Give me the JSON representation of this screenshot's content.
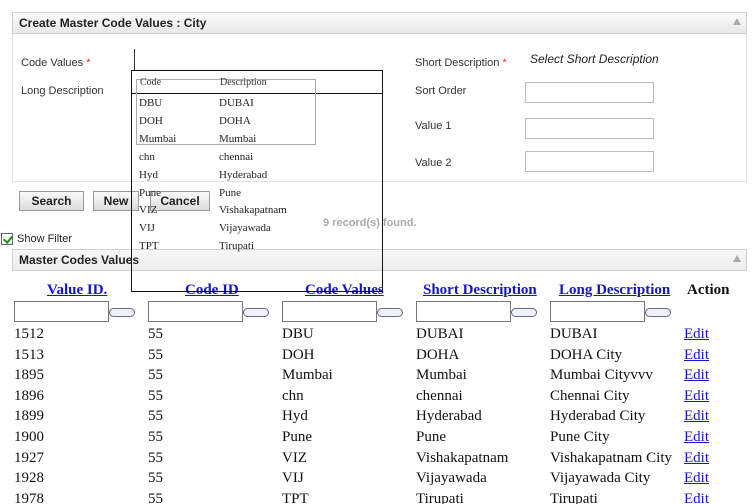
{
  "create_panel": {
    "title": "Create Master Code Values : City",
    "code_values_label": "Code Values",
    "long_description_label": "Long Description",
    "short_description_label": "Short Description",
    "short_description_value": "Select Short Description",
    "sort_order_label": "Sort Order",
    "value1_label": "Value 1",
    "value2_label": "Value 2",
    "required_mark": "*"
  },
  "buttons": {
    "search": "Search",
    "new": "New",
    "cancel": "Cancel"
  },
  "records_found": "9 record(s) found.",
  "show_filter": "Show Filter",
  "list_panel": {
    "title": "Master Codes Values"
  },
  "lookup": {
    "headers": {
      "code": "Code",
      "description": "Description"
    },
    "rows": [
      {
        "code": "DBU",
        "description": "DUBAI"
      },
      {
        "code": "DOH",
        "description": "DOHA"
      },
      {
        "code": "Mumbai",
        "description": "Mumbai"
      },
      {
        "code": "chn",
        "description": "chennai"
      },
      {
        "code": "Hyd",
        "description": "Hyderabad"
      },
      {
        "code": "Pune",
        "description": "Pune"
      },
      {
        "code": "VIZ",
        "description": "Vishakapatnam"
      },
      {
        "code": "VIJ",
        "description": "Vijayawada"
      },
      {
        "code": "TPT",
        "description": "Tirupati"
      }
    ]
  },
  "table": {
    "columns": [
      "Value ID.",
      "Code ID",
      "Code Values",
      "Short Description",
      "Long Description",
      "Action"
    ],
    "rows": [
      {
        "value_id": "1512",
        "code_id": "55",
        "code_value": "DBU",
        "short": "DUBAI",
        "long": "DUBAI",
        "action": "Edit"
      },
      {
        "value_id": "1513",
        "code_id": "55",
        "code_value": "DOH",
        "short": "DOHA",
        "long": "DOHA City",
        "action": "Edit"
      },
      {
        "value_id": "1895",
        "code_id": "55",
        "code_value": "Mumbai",
        "short": "Mumbai",
        "long": "Mumbai Cityvvv",
        "action": "Edit"
      },
      {
        "value_id": "1896",
        "code_id": "55",
        "code_value": "chn",
        "short": "chennai",
        "long": "Chennai City",
        "action": "Edit"
      },
      {
        "value_id": "1899",
        "code_id": "55",
        "code_value": "Hyd",
        "short": "Hyderabad",
        "long": "Hyderabad City",
        "action": "Edit"
      },
      {
        "value_id": "1900",
        "code_id": "55",
        "code_value": "Pune",
        "short": "Pune",
        "long": "Pune City",
        "action": "Edit"
      },
      {
        "value_id": "1927",
        "code_id": "55",
        "code_value": "VIZ",
        "short": "Vishakapatnam",
        "long": "Vishakapatnam City",
        "action": "Edit"
      },
      {
        "value_id": "1928",
        "code_id": "55",
        "code_value": "VIJ",
        "short": "Vijayawada",
        "long": "Vijayawada City",
        "action": "Edit"
      },
      {
        "value_id": "1978",
        "code_id": "55",
        "code_value": "TPT",
        "short": "Tirupati",
        "long": "Tirupati",
        "action": "Edit"
      }
    ]
  }
}
